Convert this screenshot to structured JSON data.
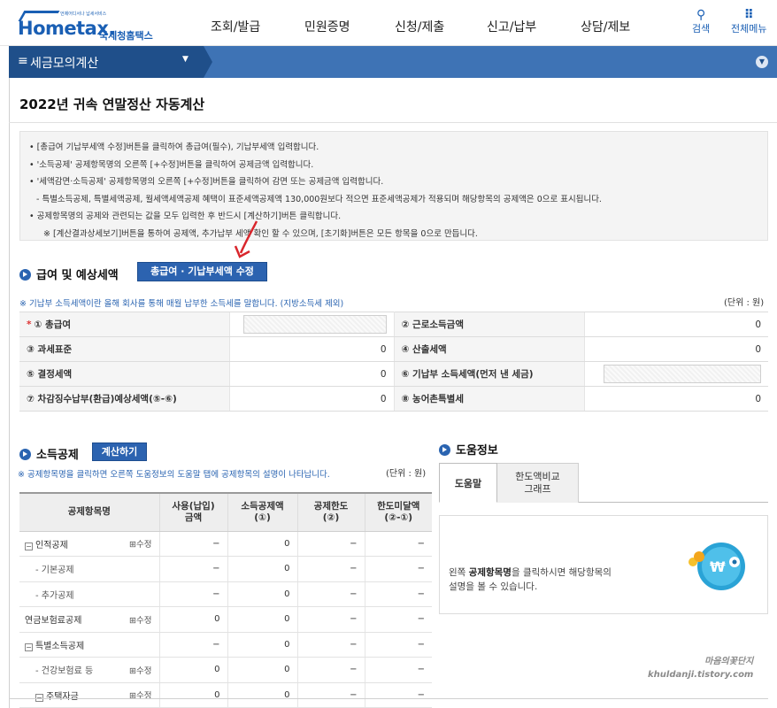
{
  "header": {
    "logo_text": "Hometax.",
    "logo_sub": "국세청홈택스",
    "logo_tiny": "언제어디서나 납세서비스",
    "gnb": [
      "조회/발급",
      "민원증명",
      "신청/제출",
      "신고/납부",
      "상담/제보"
    ],
    "search_label": "검색",
    "allmenu_label": "전체메뉴"
  },
  "navbar": {
    "menu_label": "세금모의계산"
  },
  "page_title": "2022년 귀속 연말정산 자동계산",
  "notice": [
    "• [총급여 기납부세액 수정]버튼을 클릭하여 총급여(필수), 기납부세액 입력합니다.",
    "• '소득공제' 공제항목명의 오른쪽 [+수정]버튼을 클릭하여 공제금액 입력합니다.",
    "• '세액감면·소득공제' 공제항목명의 오른쪽 [+수정]버튼을 클릭하여 감면 또는 공제금액 입력합니다.",
    "- 특별소득공제, 특별세액공제, 월세액세액공제 혜택이 표준세액공제액 130,000원보다 적으면 표준세액공제가 적용되며 해당항목의 공제액은 0으로 표시됩니다.",
    "• 공제항목명의 공제와 관련되는 값을 모두 입력한 후 반드시 [계산하기]버튼 클릭합니다.",
    "※ [계산결과상세보기]버튼을 통하여 공제액, 추가납부 세액 확인 할 수 있으며, [초기화]버튼은 모든 항목을 0으로 만듭니다."
  ],
  "salary_section": {
    "title": "급여 및 예상세액",
    "button": "총급여 · 기납부세액 수정",
    "note": "※ 기납부 소득세액이란 올해 회사를 통해 매월 납부한 소득세를 말합니다. (지방소득세 제외)",
    "unit": "(단위 : 원)",
    "rows": [
      {
        "l1": "① 총급여",
        "v1": "",
        "l2": "② 근로소득금액",
        "v2": "0"
      },
      {
        "l1": "③ 과세표준",
        "v1": "0",
        "l2": "④ 산출세액",
        "v2": "0"
      },
      {
        "l1": "⑤ 결정세액",
        "v1": "0",
        "l2": "⑥ 기납부 소득세액(먼저 낸 세금)",
        "v2": ""
      },
      {
        "l1": "⑦ 차감징수납부(환급)예상세액(⑤-⑥)",
        "v1": "0",
        "l2": "⑧ 농어촌특별세",
        "v2": "0"
      }
    ]
  },
  "deduction_section": {
    "title": "소득공제",
    "button": "계산하기",
    "note": "※ 공제항목명을 클릭하면 오른쪽 도움정보의 도움말 탭에 공제항목의 설명이 나타납니다.",
    "unit": "(단위 : 원)",
    "headers": [
      "공제항목명",
      "사용(납입)\n금액",
      "소득공제액\n(①)",
      "공제한도\n(②)",
      "한도미달액\n(②-①)"
    ],
    "rows": [
      {
        "name": "인적공제",
        "box": "−",
        "mod": "⊞수정",
        "c1": "−",
        "c2": "0",
        "c3": "−",
        "c4": "−"
      },
      {
        "name": "- 기본공제",
        "box": "",
        "mod": "",
        "c1": "−",
        "c2": "0",
        "c3": "−",
        "c4": "−"
      },
      {
        "name": "- 추가공제",
        "box": "",
        "mod": "",
        "c1": "−",
        "c2": "0",
        "c3": "−",
        "c4": "−"
      },
      {
        "name": "연금보험료공제",
        "box": "",
        "mod": "⊞수정",
        "c1": "0",
        "c2": "0",
        "c3": "−",
        "c4": "−"
      },
      {
        "name": "특별소득공제",
        "box": "−",
        "mod": "",
        "c1": "−",
        "c2": "0",
        "c3": "−",
        "c4": "−"
      },
      {
        "name": "- 건강보험료 등",
        "box": "",
        "mod": "⊞수정",
        "c1": "0",
        "c2": "0",
        "c3": "−",
        "c4": "−"
      },
      {
        "name": "주택자금",
        "box": "−",
        "mod": "⊞수정",
        "c1": "0",
        "c2": "0",
        "c3": "−",
        "c4": "−"
      }
    ]
  },
  "help": {
    "title": "도움정보",
    "tab_active": "도움말",
    "tab_other_1": "한도액비교",
    "tab_other_2": "그래프",
    "text_pre": "왼쪽 ",
    "text_bold": "공제항목명",
    "text_post": "을 클릭하시면 해당항목의",
    "text_line2": "설명을 볼 수 있습니다."
  },
  "watermark": {
    "line1": "마음의꽃단지",
    "line2": "khuldanji.tistory.com"
  },
  "colors": {
    "brand_blue": "#1a5fb4",
    "nav_blue": "#3e73b5",
    "nav_dark": "#1f4f8a",
    "button_blue": "#2c63b0",
    "arrow_red": "#d9262c"
  }
}
